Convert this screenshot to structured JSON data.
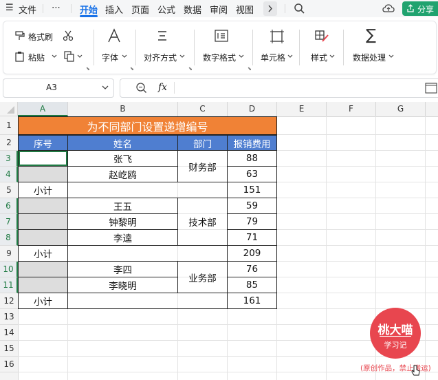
{
  "menu": {
    "hamburger": "☰",
    "file": "文件",
    "more": "⋯",
    "tabs": [
      "开始",
      "插入",
      "页面",
      "公式",
      "数据",
      "审阅",
      "视图"
    ],
    "share": "分享"
  },
  "ribbon": {
    "format_painter": "格式刷",
    "paste": "粘贴",
    "font": "字体",
    "align": "对齐方式",
    "number_format": "数字格式",
    "cells": "单元格",
    "styles": "样式",
    "data_process": "数据处理"
  },
  "formula_bar": {
    "cell_ref": "A3",
    "fx": "fx",
    "value": ""
  },
  "columns": [
    "A",
    "B",
    "C",
    "D",
    "E",
    "F",
    "G"
  ],
  "rows": [
    "1",
    "2",
    "3",
    "4",
    "5",
    "6",
    "7",
    "8",
    "9",
    "10",
    "11",
    "12",
    "13",
    "14",
    "15",
    "16"
  ],
  "sheet": {
    "title": "为不同部门设置递增编号",
    "headers": [
      "序号",
      "姓名",
      "部门",
      "报销费用"
    ],
    "names": [
      "张飞",
      "赵屹鸥",
      "王五",
      "钟黎明",
      "李逵",
      "李四",
      "李晓明"
    ],
    "departments": [
      "财务部",
      "技术部",
      "业务部"
    ],
    "amounts": [
      "88",
      "63",
      "151",
      "59",
      "79",
      "71",
      "209",
      "76",
      "85",
      "161"
    ],
    "subtotal": "小计"
  },
  "watermark": {
    "line1": "桃大喵",
    "line2": "学习记",
    "note": "(原创作品，禁止搬运)"
  },
  "colors": {
    "title_bg": "#f08236",
    "header_bg": "#4f7ed0",
    "active_tab": "#1a73e8",
    "selection": "#1f7a43",
    "share_button": "#20a36f",
    "stamp": "#e8464f"
  }
}
